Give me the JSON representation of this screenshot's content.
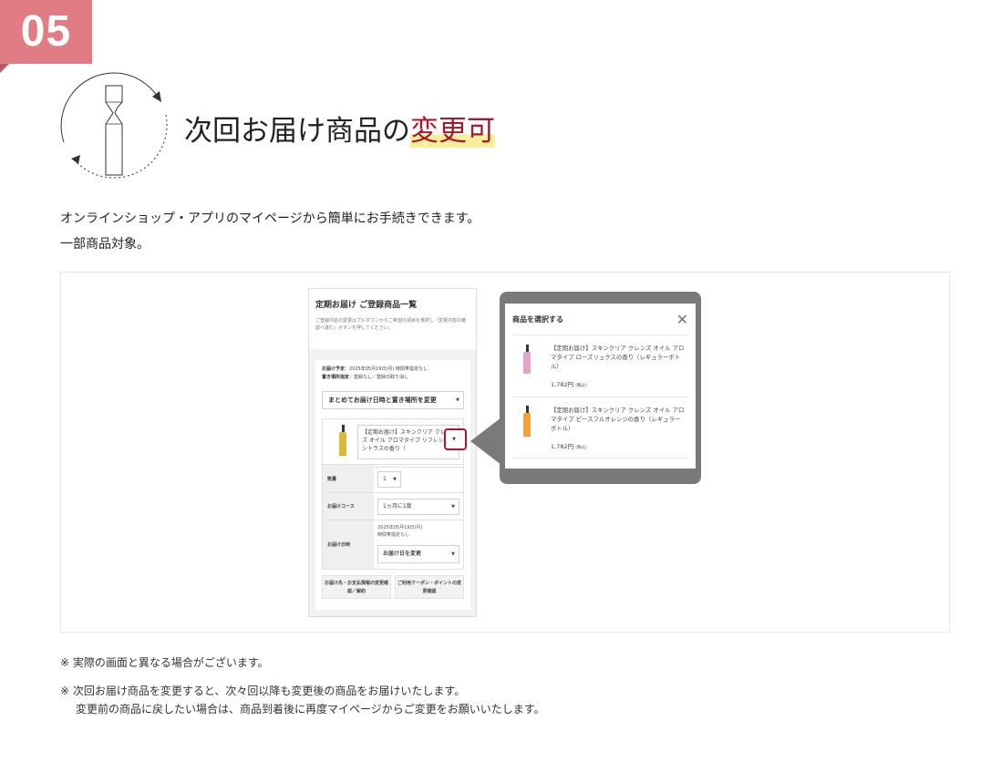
{
  "section": {
    "number": "05",
    "title_prefix": "次回お届け商品の",
    "title_highlight": "変更可",
    "desc_line1": "オンラインショップ・アプリのマイページから簡単にお手続きできます。",
    "desc_line2": "一部商品対象。"
  },
  "phone": {
    "title": "定期お届け ご登録商品一覧",
    "note": "ご登録内容の変更はプルダウンからご希望の項目を選択し「変更内容の確認へ進む」ボタンを押してください。",
    "info": {
      "date_label": "お届け予定",
      "date_value": "：2025年05月19日(月) 時間帯指定なし",
      "place_label": "置き場所指定",
      "place_value": "：登録なし／登録の取り消し"
    },
    "bulk_change": "まとめてお届け日時と置き場所を変更",
    "product_select": "【定期お届け】スキンクリア クレンズ オイル アロマタイプ リフレシングシトラスの香り（",
    "quantity_label": "数量",
    "quantity_value": "1",
    "course_label": "お届けコース",
    "course_value": "1ヵ月に1度",
    "delivery_label": "お届け日時",
    "delivery_date": "2025年05月19日(月)",
    "delivery_time": "時間帯指定なし",
    "delivery_change": "お届け日を変更",
    "btn_address": "お届け先・お支払情報の変更確認／解約",
    "btn_coupon": "ご利用クーポン・ポイントの変更確認"
  },
  "popup": {
    "title": "商品を選択する",
    "items": [
      {
        "name": "【定期お届け】スキンクリア クレンズ オイル アロマタイプ ローズリュクスの香り（レギュラーボトル）",
        "price": "1,782円",
        "tax": "(税込)",
        "color": "#e5a3c6"
      },
      {
        "name": "【定期お届け】スキンクリア クレンズ オイル アロマタイプ ピースフルオレンジの香り（レギュラーボトル）",
        "price": "1,782円",
        "tax": "(税込)",
        "color": "#f0a13a"
      }
    ]
  },
  "notes": {
    "note1": "※ 実際の画面と異なる場合がございます。",
    "note2_line1": "※ 次回お届け商品を変更すると、次々回以降も変更後の商品をお届けいたします。",
    "note2_line2": "変更前の商品に戻したい場合は、商品到着後に再度マイページからご変更をお願いいたします。"
  },
  "colors": {
    "badge": "#e07c84",
    "highlight_text": "#a8182a",
    "highlight_marker": "#f7ef9a",
    "popup_frame": "#7a7a7a"
  },
  "icons": {
    "cycle": "bottle-cycle-icon",
    "close": "close-icon",
    "caret": "caret-down-icon"
  }
}
